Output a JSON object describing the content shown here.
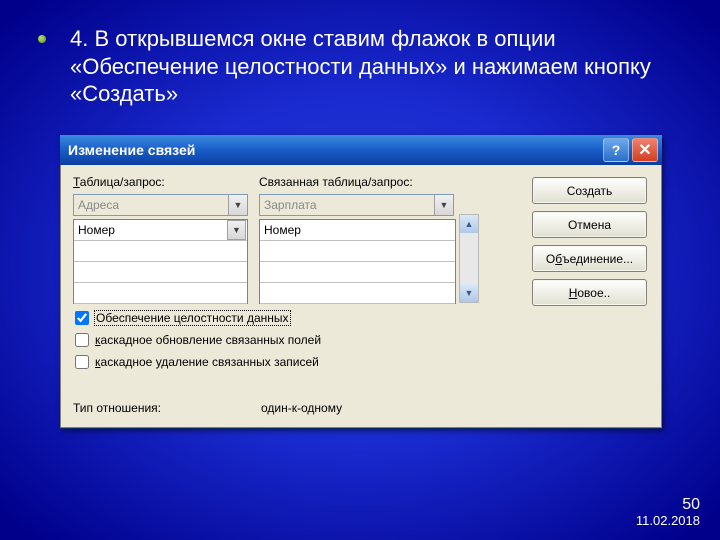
{
  "slide": {
    "instruction": "4. В открывшемся окне ставим флажок в опции «Обеспечение целостности данных» и нажимаем кнопку «Создать»",
    "page_number": "50",
    "date": "11.02.2018"
  },
  "dialog": {
    "title": "Изменение связей",
    "labels": {
      "table_query": "Таблица/запрос:",
      "related_table_query": "Связанная таблица/запрос:",
      "relation_type": "Тип отношения:",
      "relation_value": "один-к-одному"
    },
    "source_table": "Адреса",
    "related_table": "Зарплата",
    "source_field": "Номер",
    "related_field": "Номер",
    "checkboxes": {
      "integrity": {
        "label": "Обеспечение целостности данных",
        "checked": true
      },
      "cascade_update": {
        "label": "каскадное обновление связанных полей",
        "checked": false
      },
      "cascade_delete": {
        "label": "каскадное удаление связанных записей",
        "checked": false
      }
    },
    "buttons": {
      "create": "Создать",
      "cancel": "Отмена",
      "join": "Объединение...",
      "new": "Новое.."
    },
    "underline_chars": {
      "table": "Т",
      "cascade_u": "к",
      "cascade_d": "к",
      "join": "б",
      "new": "Н"
    }
  }
}
